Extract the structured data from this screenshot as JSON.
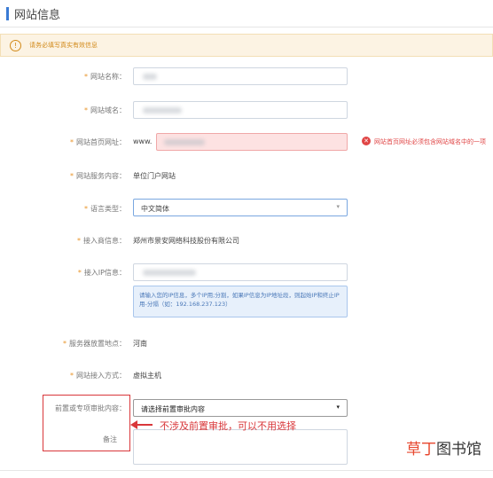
{
  "header": {
    "title": "网站信息"
  },
  "notice": {
    "icon": "info-icon",
    "text": "请务必填写真实有效信息"
  },
  "form": {
    "site_name": {
      "label": "网站名称："
    },
    "site_domain": {
      "label": "网站域名："
    },
    "home_url": {
      "label": "网站首页网址：",
      "prefix": "www.",
      "error": "网站首页网址必须包含网站域名中的一项"
    },
    "service": {
      "label": "网站服务内容：",
      "value": "单位门户网站"
    },
    "language": {
      "label": "语言类型：",
      "value": "中文简体"
    },
    "isp": {
      "label": "接入商信息：",
      "value": "郑州市景安网络科技股份有限公司"
    },
    "ip": {
      "label": "接入IP信息：",
      "hint": "请输入您的IP信息，多个IP用;分割，如果IP信息为IP地址段，则起始IP和终止IP用-分隔（如：192.168.237.123）"
    },
    "location": {
      "label": "服务器放置地点：",
      "value": "河南"
    },
    "access": {
      "label": "网站接入方式：",
      "value": "虚拟主机"
    },
    "approval": {
      "label": "前置或专项审批内容：",
      "value": "请选择前置审批内容"
    },
    "remark": {
      "label": "备注"
    }
  },
  "annotation": {
    "text": "不涉及前置审批，可以不用选择"
  },
  "watermark": {
    "part1": "草丁",
    "part2": "图书馆"
  },
  "colors": {
    "accent": "#3a7bd5",
    "required": "#e8952a",
    "error": "#e04545",
    "annotation": "#d9373a"
  }
}
